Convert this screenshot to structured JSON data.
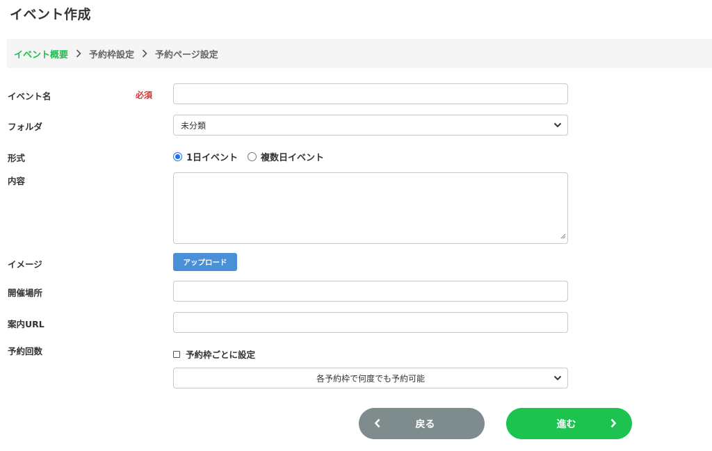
{
  "page": {
    "title": "イベント作成"
  },
  "steps": [
    {
      "label": "イベント概要",
      "active": true
    },
    {
      "label": "予約枠設定",
      "active": false
    },
    {
      "label": "予約ページ設定",
      "active": false
    }
  ],
  "form": {
    "event_name": {
      "label": "イベント名",
      "required_label": "必須",
      "value": ""
    },
    "folder": {
      "label": "フォルダ",
      "selected": "未分類"
    },
    "format": {
      "label": "形式",
      "options": [
        "1日イベント",
        "複数日イベント"
      ],
      "selected_index": 0
    },
    "content": {
      "label": "内容",
      "value": ""
    },
    "image": {
      "label": "イメージ",
      "button": "アップロード"
    },
    "venue": {
      "label": "開催場所",
      "value": ""
    },
    "guide_url": {
      "label": "案内URL",
      "value": ""
    },
    "booking_count": {
      "label": "予約回数",
      "checkbox_label": "予約枠ごとに設定",
      "checked": false,
      "selected": "各予約枠で何度でも予約可能"
    }
  },
  "actions": {
    "back": "戻る",
    "next": "進む"
  },
  "colors": {
    "accent_green": "#1cc44f",
    "required_red": "#e3312b",
    "upload_blue": "#4a90d9",
    "back_gray": "#7f8c8d"
  },
  "icons": {
    "step_separator": "chevron-right-icon",
    "select": "chevron-down-icon",
    "back": "chevron-left-icon",
    "next": "chevron-right-icon"
  }
}
